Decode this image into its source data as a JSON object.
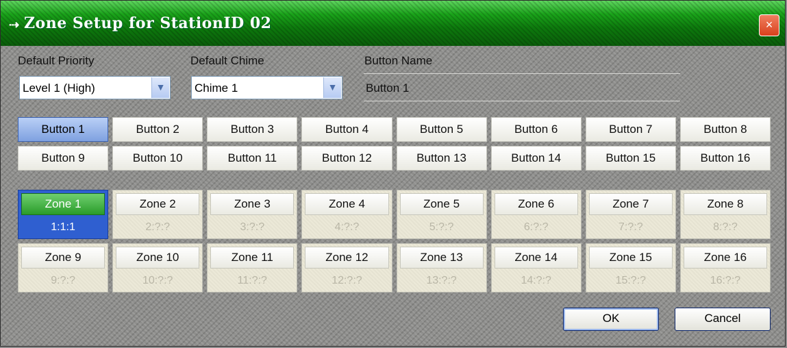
{
  "window": {
    "title": "Zone Setup for StationID 02",
    "close_glyph": "×"
  },
  "priority": {
    "label": "Default Priority",
    "value": "Level 1 (High)"
  },
  "chime": {
    "label": "Default Chime",
    "value": "Chime 1"
  },
  "button_name": {
    "label": "Button Name",
    "value": "Button 1"
  },
  "buttons": [
    {
      "label": "Button 1",
      "selected": true
    },
    {
      "label": "Button 2"
    },
    {
      "label": "Button 3"
    },
    {
      "label": "Button 4"
    },
    {
      "label": "Button 5"
    },
    {
      "label": "Button 6"
    },
    {
      "label": "Button 7"
    },
    {
      "label": "Button 8"
    },
    {
      "label": "Button 9"
    },
    {
      "label": "Button 10"
    },
    {
      "label": "Button 11"
    },
    {
      "label": "Button 12"
    },
    {
      "label": "Button 13"
    },
    {
      "label": "Button 14"
    },
    {
      "label": "Button 15"
    },
    {
      "label": "Button 16"
    }
  ],
  "zones": [
    {
      "label": "Zone 1",
      "address": "1:1:1",
      "active": true
    },
    {
      "label": "Zone 2",
      "address": "2:?:?"
    },
    {
      "label": "Zone 3",
      "address": "3:?:?"
    },
    {
      "label": "Zone 4",
      "address": "4:?:?"
    },
    {
      "label": "Zone 5",
      "address": "5:?:?"
    },
    {
      "label": "Zone 6",
      "address": "6:?:?"
    },
    {
      "label": "Zone 7",
      "address": "7:?:?"
    },
    {
      "label": "Zone 8",
      "address": "8:?:?"
    },
    {
      "label": "Zone 9",
      "address": "9:?:?"
    },
    {
      "label": "Zone 10",
      "address": "10:?:?"
    },
    {
      "label": "Zone 11",
      "address": "11:?:?"
    },
    {
      "label": "Zone 12",
      "address": "12:?:?"
    },
    {
      "label": "Zone 13",
      "address": "13:?:?"
    },
    {
      "label": "Zone 14",
      "address": "14:?:?"
    },
    {
      "label": "Zone 15",
      "address": "15:?:?"
    },
    {
      "label": "Zone 16",
      "address": "16:?:?"
    }
  ],
  "actions": {
    "ok": "OK",
    "cancel": "Cancel"
  }
}
